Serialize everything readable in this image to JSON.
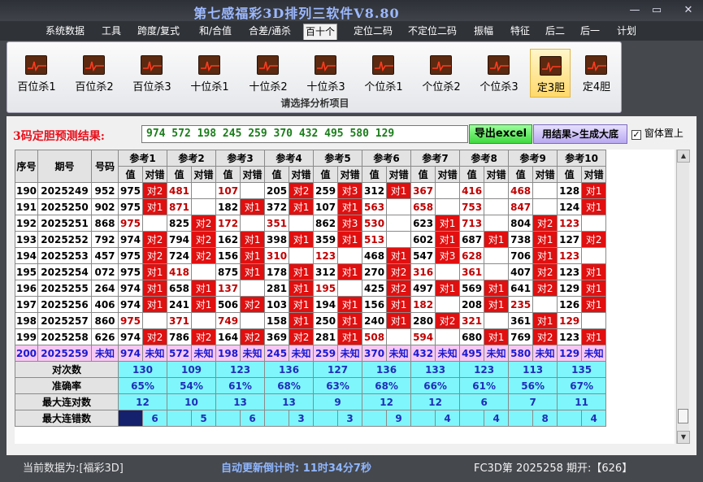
{
  "app": {
    "title": "第七感福彩3D排列三软件V8.80"
  },
  "window_controls": {
    "minimize": "—",
    "restore": "▭",
    "close": "✕"
  },
  "menu": [
    "系统数据",
    "工具",
    "跨度/复式",
    "和/合值",
    "合差/通杀",
    "百十个",
    "定位二码",
    "不定位二码",
    "振幅",
    "特征",
    "后二",
    "后一",
    "计划"
  ],
  "menu_active": "百十个",
  "ribbon": {
    "buttons": [
      "百位杀1",
      "百位杀2",
      "百位杀3",
      "十位杀1",
      "十位杀2",
      "十位杀3",
      "个位杀1",
      "个位杀2",
      "个位杀3",
      "定3胆",
      "定4胆"
    ],
    "selected": "定3胆",
    "caption": "请选择分析项目",
    "icon": "chart-icon"
  },
  "prediction": {
    "label": "3码定胆预测结果:",
    "value": "974  572  198  245  259  370  432  495  580  129",
    "excel_button": "导出excel",
    "bigbottom_button": "用结果>生成大底",
    "on_top_label": "窗体置上",
    "on_top_checked": "✓"
  },
  "table": {
    "headers": {
      "seq": "序号",
      "period": "期号",
      "code": "号码",
      "val": "值",
      "hit": "对错"
    },
    "refs": [
      "参考1",
      "参考2",
      "参考3",
      "参考4",
      "参考5",
      "参考6",
      "参考7",
      "参考8",
      "参考9",
      "参考10"
    ],
    "rows": [
      {
        "seq": "190",
        "period": "2025249",
        "code": "952",
        "cells": [
          [
            "975",
            "对2"
          ],
          [
            "481",
            ""
          ],
          [
            "107",
            ""
          ],
          [
            "205",
            "对2"
          ],
          [
            "259",
            "对3"
          ],
          [
            "312",
            "对1"
          ],
          [
            "367",
            ""
          ],
          [
            "416",
            ""
          ],
          [
            "468",
            ""
          ],
          [
            "128",
            "对1"
          ]
        ]
      },
      {
        "seq": "191",
        "period": "2025250",
        "code": "902",
        "cells": [
          [
            "975",
            "对1"
          ],
          [
            "871",
            ""
          ],
          [
            "182",
            "对1"
          ],
          [
            "372",
            "对1"
          ],
          [
            "107",
            "对1"
          ],
          [
            "563",
            ""
          ],
          [
            "658",
            ""
          ],
          [
            "753",
            ""
          ],
          [
            "847",
            ""
          ],
          [
            "124",
            "对1"
          ]
        ]
      },
      {
        "seq": "192",
        "period": "2025251",
        "code": "868",
        "cells": [
          [
            "975",
            ""
          ],
          [
            "825",
            "对2"
          ],
          [
            "172",
            ""
          ],
          [
            "351",
            ""
          ],
          [
            "862",
            "对3"
          ],
          [
            "530",
            ""
          ],
          [
            "623",
            "对1"
          ],
          [
            "713",
            ""
          ],
          [
            "804",
            "对2"
          ],
          [
            "123",
            ""
          ]
        ]
      },
      {
        "seq": "193",
        "period": "2025252",
        "code": "792",
        "cells": [
          [
            "974",
            "对2"
          ],
          [
            "794",
            "对2"
          ],
          [
            "162",
            "对1"
          ],
          [
            "398",
            "对1"
          ],
          [
            "359",
            "对1"
          ],
          [
            "513",
            ""
          ],
          [
            "602",
            "对1"
          ],
          [
            "687",
            "对1"
          ],
          [
            "738",
            "对1"
          ],
          [
            "127",
            "对2"
          ]
        ]
      },
      {
        "seq": "194",
        "period": "2025253",
        "code": "457",
        "cells": [
          [
            "975",
            "对2"
          ],
          [
            "724",
            "对2"
          ],
          [
            "156",
            "对1"
          ],
          [
            "310",
            ""
          ],
          [
            "123",
            ""
          ],
          [
            "468",
            "对1"
          ],
          [
            "547",
            "对3"
          ],
          [
            "628",
            ""
          ],
          [
            "706",
            "对1"
          ],
          [
            "123",
            ""
          ]
        ]
      },
      {
        "seq": "195",
        "period": "2025254",
        "code": "072",
        "cells": [
          [
            "975",
            "对1"
          ],
          [
            "418",
            ""
          ],
          [
            "875",
            "对1"
          ],
          [
            "178",
            "对1"
          ],
          [
            "312",
            "对1"
          ],
          [
            "270",
            "对2"
          ],
          [
            "316",
            ""
          ],
          [
            "361",
            ""
          ],
          [
            "407",
            "对2"
          ],
          [
            "123",
            "对1"
          ]
        ]
      },
      {
        "seq": "196",
        "period": "2025255",
        "code": "264",
        "cells": [
          [
            "974",
            "对1"
          ],
          [
            "658",
            "对1"
          ],
          [
            "137",
            ""
          ],
          [
            "281",
            "对1"
          ],
          [
            "195",
            ""
          ],
          [
            "425",
            "对2"
          ],
          [
            "497",
            "对1"
          ],
          [
            "569",
            "对1"
          ],
          [
            "641",
            "对2"
          ],
          [
            "129",
            "对1"
          ]
        ]
      },
      {
        "seq": "197",
        "period": "2025256",
        "code": "406",
        "cells": [
          [
            "974",
            "对1"
          ],
          [
            "241",
            "对1"
          ],
          [
            "506",
            "对2"
          ],
          [
            "103",
            "对1"
          ],
          [
            "194",
            "对1"
          ],
          [
            "156",
            "对1"
          ],
          [
            "182",
            ""
          ],
          [
            "208",
            "对1"
          ],
          [
            "235",
            ""
          ],
          [
            "126",
            "对1"
          ]
        ]
      },
      {
        "seq": "198",
        "period": "2025257",
        "code": "860",
        "cells": [
          [
            "975",
            ""
          ],
          [
            "371",
            ""
          ],
          [
            "749",
            ""
          ],
          [
            "158",
            "对1"
          ],
          [
            "250",
            "对1"
          ],
          [
            "240",
            "对1"
          ],
          [
            "280",
            "对2"
          ],
          [
            "321",
            ""
          ],
          [
            "361",
            "对1"
          ],
          [
            "129",
            ""
          ]
        ]
      },
      {
        "seq": "199",
        "period": "2025258",
        "code": "626",
        "cells": [
          [
            "974",
            "对2"
          ],
          [
            "786",
            "对2"
          ],
          [
            "164",
            "对2"
          ],
          [
            "369",
            "对2"
          ],
          [
            "281",
            "对1"
          ],
          [
            "508",
            ""
          ],
          [
            "594",
            ""
          ],
          [
            "680",
            "对1"
          ],
          [
            "769",
            "对2"
          ],
          [
            "123",
            "对1"
          ]
        ]
      },
      {
        "seq": "200",
        "period": "2025259",
        "code": "未知",
        "cells": [
          [
            "974",
            "未知"
          ],
          [
            "572",
            "未知"
          ],
          [
            "198",
            "未知"
          ],
          [
            "245",
            "未知"
          ],
          [
            "259",
            "未知"
          ],
          [
            "370",
            "未知"
          ],
          [
            "432",
            "未知"
          ],
          [
            "495",
            "未知"
          ],
          [
            "580",
            "未知"
          ],
          [
            "129",
            "未知"
          ]
        ]
      }
    ],
    "stats": [
      {
        "label": "对次数",
        "values": [
          "130",
          "109",
          "123",
          "136",
          "127",
          "136",
          "133",
          "123",
          "113",
          "135"
        ]
      },
      {
        "label": "准确率",
        "values": [
          "65%",
          "54%",
          "61%",
          "68%",
          "63%",
          "68%",
          "66%",
          "61%",
          "56%",
          "67%"
        ]
      },
      {
        "label": "最大连对数",
        "values": [
          "12",
          "10",
          "13",
          "13",
          "9",
          "12",
          "12",
          "6",
          "7",
          "11"
        ]
      },
      {
        "label": "最大连错数",
        "values": [
          "6",
          "5",
          "6",
          "3",
          "3",
          "9",
          "4",
          "4",
          "8",
          "4"
        ]
      }
    ]
  },
  "status": {
    "current_data": "当前数据为:[福彩3D]",
    "countdown": "自动更新倒计时:  11时34分7秒",
    "latest": "FC3D第  2025258  期开:【626】"
  },
  "colors": {
    "hit": "#e01010",
    "miss_text": "#c00000",
    "stat_bg": "#7ff6fb",
    "unknown_bg": "#f8c8f4",
    "title": "#9cb8ff"
  }
}
